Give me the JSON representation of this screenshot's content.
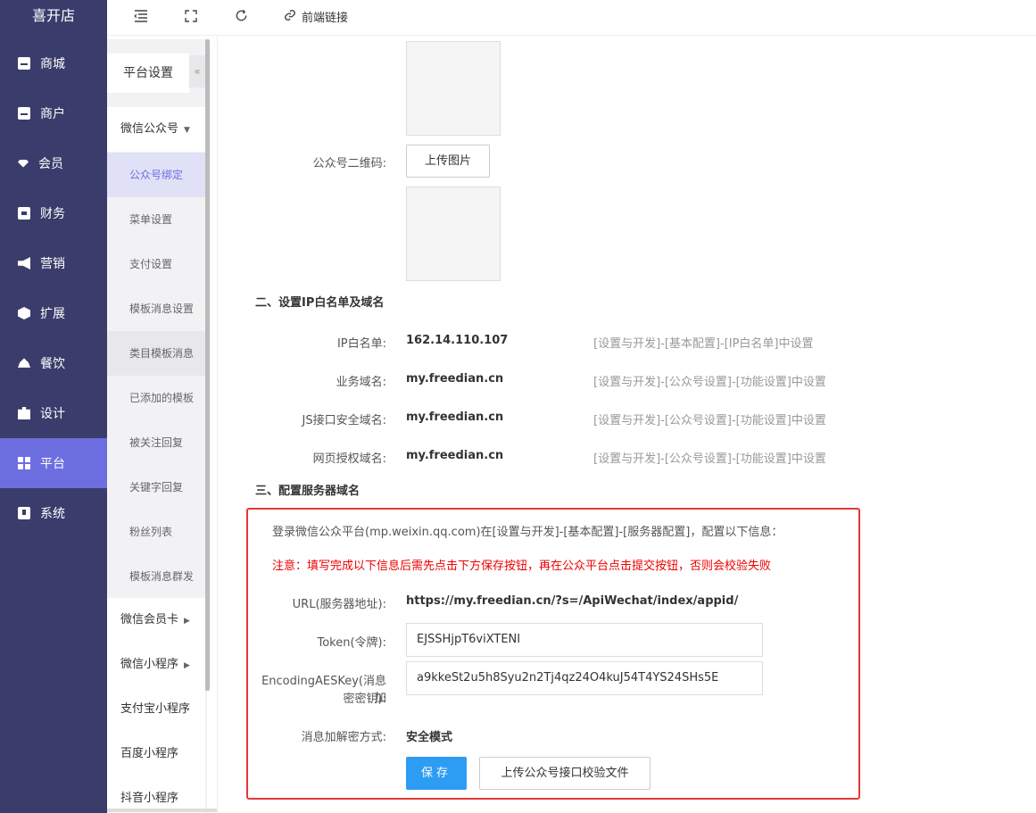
{
  "brand": "喜开店",
  "main_nav": [
    {
      "label": "商城",
      "icon": "store-icon"
    },
    {
      "label": "商户",
      "icon": "merchant-icon"
    },
    {
      "label": "会员",
      "icon": "member-icon"
    },
    {
      "label": "财务",
      "icon": "finance-icon"
    },
    {
      "label": "营销",
      "icon": "marketing-icon"
    },
    {
      "label": "扩展",
      "icon": "extension-icon"
    },
    {
      "label": "餐饮",
      "icon": "dining-icon"
    },
    {
      "label": "设计",
      "icon": "design-icon"
    },
    {
      "label": "平台",
      "icon": "platform-icon"
    },
    {
      "label": "系统",
      "icon": "system-icon"
    }
  ],
  "topbar": {
    "link_label": "前端链接"
  },
  "sub_nav": {
    "title": "平台设置",
    "collapse": "«",
    "groups": {
      "wechat_official": "微信公众号",
      "wechat_card": "微信会员卡",
      "wechat_mini": "微信小程序",
      "alipay_mini": "支付宝小程序",
      "baidu_mini": "百度小程序",
      "douyin_mini": "抖音小程序"
    },
    "items": [
      "公众号绑定",
      "菜单设置",
      "支付设置",
      "模板消息设置",
      "类目模板消息",
      "已添加的模板",
      "被关注回复",
      "关键字回复",
      "粉丝列表",
      "模板消息群发"
    ]
  },
  "form": {
    "qrcode_label": "公众号二维码:",
    "upload_image": "上传图片",
    "section2_title": "二、设置IP白名单及域名",
    "rows": [
      {
        "label": "IP白名单:",
        "value": "162.14.110.107",
        "hint": "[设置与开发]-[基本配置]-[IP白名单]中设置"
      },
      {
        "label": "业务域名:",
        "value": "my.freedian.cn",
        "hint": "[设置与开发]-[公众号设置]-[功能设置]中设置"
      },
      {
        "label": "JS接口安全域名:",
        "value": "my.freedian.cn",
        "hint": "[设置与开发]-[公众号设置]-[功能设置]中设置"
      },
      {
        "label": "网页授权域名:",
        "value": "my.freedian.cn",
        "hint": "[设置与开发]-[公众号设置]-[功能设置]中设置"
      }
    ],
    "section3_title": "三、配置服务器域名",
    "notice": "登录微信公众平台(mp.weixin.qq.com)在[设置与开发]-[基本配置]-[服务器配置]，配置以下信息：",
    "warning": "注意：填写完成以下信息后需先点击下方保存按钮，再在公众平台点击提交按钮，否则会校验失败",
    "url_label": "URL(服务器地址):",
    "url_value": "https://my.freedian.cn/?s=/ApiWechat/index/appid/",
    "token_label": "Token(令牌):",
    "token_value": "EJSSHjpT6viXTENI",
    "aes_label_1": "EncodingAESKey(消息加",
    "aes_label_2": "密密钥):",
    "aes_value": "a9kkeSt2u5h8Syu2n2Tj4qz24O4kuJ54T4YS24SHs5E",
    "mode_label": "消息加解密方式:",
    "mode_value": "安全模式",
    "save_button": "保存",
    "upload_verify_button": "上传公众号接口校验文件"
  },
  "colors": {
    "sidebar_bg": "#3a3c6b",
    "active_nav": "#6c6ee0",
    "primary_button": "#2d9cf3",
    "warning_text": "#e00000",
    "highlight_border": "#e53935"
  }
}
